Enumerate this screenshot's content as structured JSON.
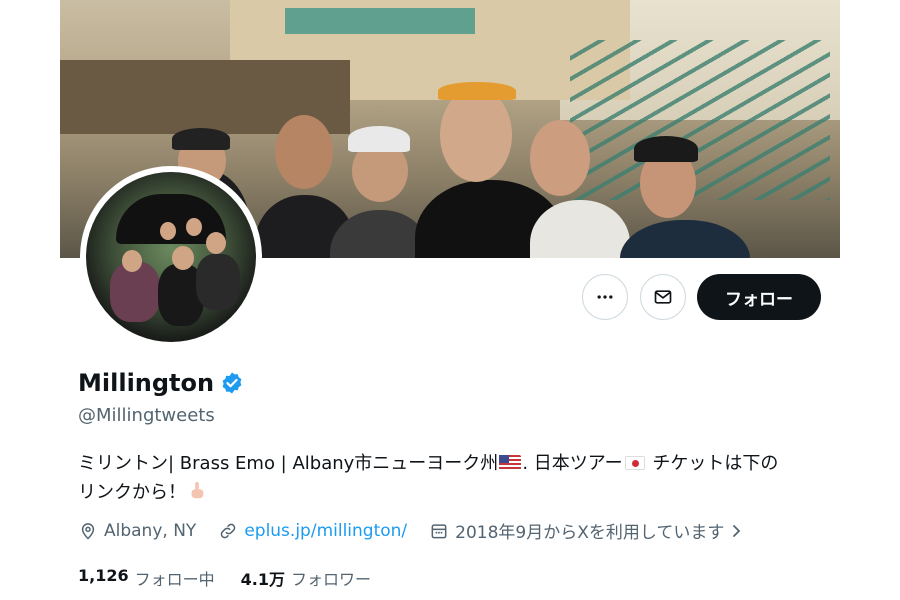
{
  "profile": {
    "display_name": "Millington",
    "handle": "@Millingtweets",
    "bio_part1": "ミリントン| Brass Emo | Albany市ニューヨーク州",
    "bio_part2": ". 日本ツアー",
    "bio_part3": " チケットは下の",
    "bio_part4": "リンクから！",
    "location": "Albany, NY",
    "website": "eplus.jp/millington/",
    "joined": "2018年9月からXを利用しています",
    "following_count": "1,126",
    "following_label": "フォロー中",
    "followers_count": "4.1万",
    "followers_label": "フォロワー"
  },
  "actions": {
    "more_icon": "more-horizontal-icon",
    "message_icon": "mail-icon",
    "follow_label": "フォロー"
  },
  "colors": {
    "verified": "#1d9bf0",
    "link": "#1d9bf0",
    "follow_button": "#0f1419",
    "secondary_text": "#536471"
  }
}
